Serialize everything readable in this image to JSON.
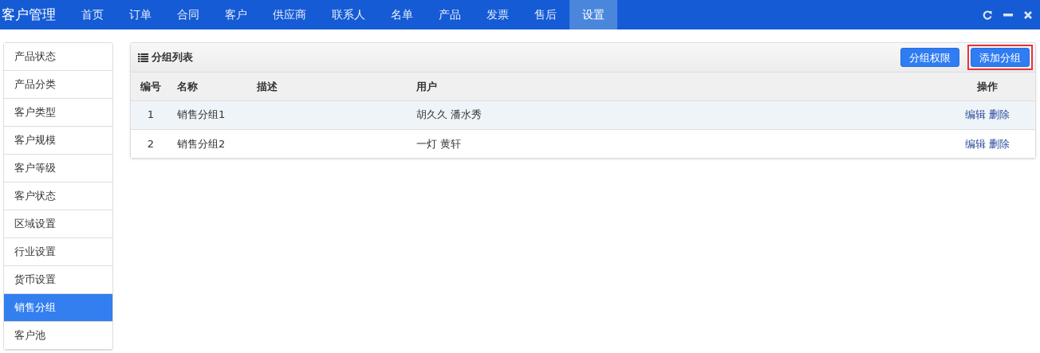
{
  "app_title": "客户管理",
  "nav": [
    {
      "label": "首页",
      "selected": false
    },
    {
      "label": "订单",
      "selected": false
    },
    {
      "label": "合同",
      "selected": false
    },
    {
      "label": "客户",
      "selected": false
    },
    {
      "label": "供应商",
      "selected": false
    },
    {
      "label": "联系人",
      "selected": false
    },
    {
      "label": "名单",
      "selected": false
    },
    {
      "label": "产品",
      "selected": false
    },
    {
      "label": "发票",
      "selected": false
    },
    {
      "label": "售后",
      "selected": false
    },
    {
      "label": "设置",
      "selected": true
    }
  ],
  "sidebar": {
    "items": [
      {
        "label": "产品状态",
        "selected": false
      },
      {
        "label": "产品分类",
        "selected": false
      },
      {
        "label": "客户类型",
        "selected": false
      },
      {
        "label": "客户规模",
        "selected": false
      },
      {
        "label": "客户等级",
        "selected": false
      },
      {
        "label": "客户状态",
        "selected": false
      },
      {
        "label": "区域设置",
        "selected": false
      },
      {
        "label": "行业设置",
        "selected": false
      },
      {
        "label": "货币设置",
        "selected": false
      },
      {
        "label": "销售分组",
        "selected": true
      },
      {
        "label": "客户池",
        "selected": false
      }
    ]
  },
  "panel": {
    "title": "分组列表",
    "buttons": [
      {
        "label": "分组权限",
        "highlighted": false
      },
      {
        "label": "添加分组",
        "highlighted": true
      }
    ],
    "table": {
      "columns": [
        "编号",
        "名称",
        "描述",
        "用户",
        "操作"
      ],
      "rows": [
        {
          "cells": [
            "1",
            "销售分组1",
            "",
            "胡久久 潘水秀"
          ],
          "actions": [
            "编辑",
            "删除"
          ]
        },
        {
          "cells": [
            "2",
            "销售分组2",
            "",
            "一灯 黄轩"
          ],
          "actions": [
            "编辑",
            "删除"
          ]
        }
      ]
    }
  }
}
